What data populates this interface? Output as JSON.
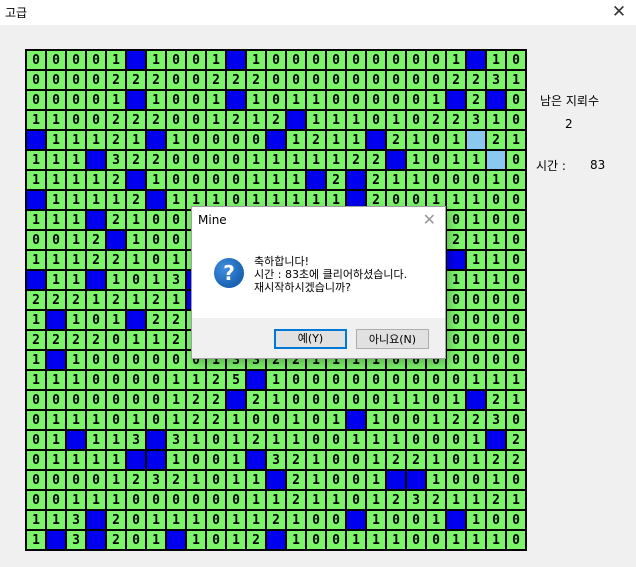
{
  "window": {
    "title": "고급",
    "close_glyph": "✕"
  },
  "status": {
    "mines_label": "남은 지뢰수",
    "mines_value": "2",
    "time_label": "시간 :",
    "time_value": "83"
  },
  "dialog": {
    "title": "Mine",
    "close_glyph": "✕",
    "icon_glyph": "?",
    "line1": "축하합니다!",
    "line2": "시간 : 83초에 클리어하셨습니다.",
    "line3": "재시작하시겠습니까?",
    "yes_label": "예(Y)",
    "no_label": "아니요(N)"
  },
  "colors": {
    "revealed": "#7cf56b",
    "flag": "#0000ee",
    "pressed": "#8bc8f0"
  },
  "board": {
    "rows": [
      "00001B1001B10000000001B10",
      "0000222002220000000002231",
      "00001B1001B1011000001B2B",
      "1100222001212B1110102231",
      "B11121B10000B1211B2101L21",
      "111B32200001111122B1011L",
      "11112B10000111B2B2110001",
      "B11112B111011111B2001110",
      "111B21000110000000000010",
      "0012B1000001211100001211",
      "111221011111B1B111001B11",
      "B11B1013B1B1121111B11111",
      "22212121B221110011121000",
      "1B101B2211111011B1101000",
      "22220112121011101001000",
      "1B100000013322111100000",
      "11100001125B10000000001110",
      "0000000122B21000001101B21",
      "0111010122100101B1001223",
      "01B113B3101211001110001B2",
      "01111BB1001B3210012210122",
      "000012321011B21001BB1001",
      "0011100000011211012321121",
      "113B201110112100B1001B10",
      "1B3B201B1012B100111001110"
    ]
  }
}
